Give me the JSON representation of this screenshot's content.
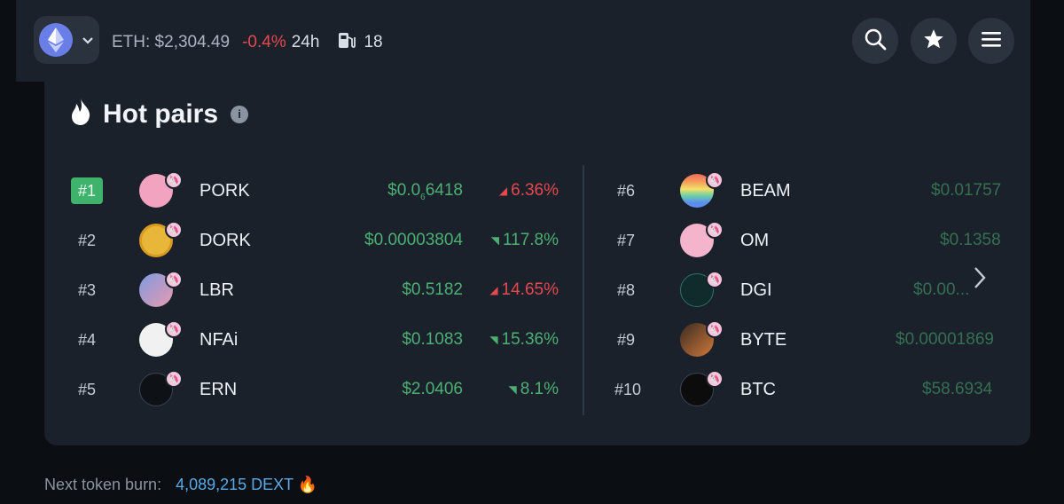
{
  "header": {
    "eth_label": "ETH: $2,304.49",
    "eth_change": "-0.4%",
    "eth_period": "24h",
    "gas_value": "18",
    "icons": [
      "ethereum-icon",
      "chevron-down-icon",
      "gas-pump-icon",
      "search-icon",
      "star-icon",
      "menu-icon"
    ]
  },
  "hot_pairs": {
    "title": "Hot pairs",
    "info_icon": "i",
    "left": [
      {
        "rank": "#1",
        "symbol": "PORK",
        "price_main": "$0.0",
        "price_sub": "6",
        "price_tail": "6418",
        "change": "6.36%",
        "dir": "down",
        "avatar_color": "#f2a3c0"
      },
      {
        "rank": "#2",
        "symbol": "DORK",
        "price": "$0.00003804",
        "change": "117.8%",
        "dir": "up",
        "avatar_color": "#e8b73a"
      },
      {
        "rank": "#3",
        "symbol": "LBR",
        "price": "$0.5182",
        "change": "14.65%",
        "dir": "down",
        "avatar_color": "#7f9be0"
      },
      {
        "rank": "#4",
        "symbol": "NFAi",
        "price": "$0.1083",
        "change": "15.36%",
        "dir": "up",
        "avatar_color": "#f1f1f1"
      },
      {
        "rank": "#5",
        "symbol": "ERN",
        "price": "$2.0406",
        "change": "8.1%",
        "dir": "up",
        "avatar_color": "#0e1116"
      }
    ],
    "right": [
      {
        "rank": "#6",
        "symbol": "BEAM",
        "price": "$0.01757"
      },
      {
        "rank": "#7",
        "symbol": "OM",
        "price": "$0.1358"
      },
      {
        "rank": "#8",
        "symbol": "DGI",
        "price": "$0.00..."
      },
      {
        "rank": "#9",
        "symbol": "BYTE",
        "price": "$0.00001869"
      },
      {
        "rank": "#10",
        "symbol": "BTC",
        "price": "$58.6934"
      }
    ]
  },
  "footer": {
    "label": "Next token burn:",
    "value": "4,089,215 DEXT",
    "emoji": "🔥"
  },
  "colors": {
    "up": "#4caf73",
    "down": "#e5484d",
    "accent_blue": "#5aa9e6",
    "rank1_badge": "#3fb36b"
  }
}
